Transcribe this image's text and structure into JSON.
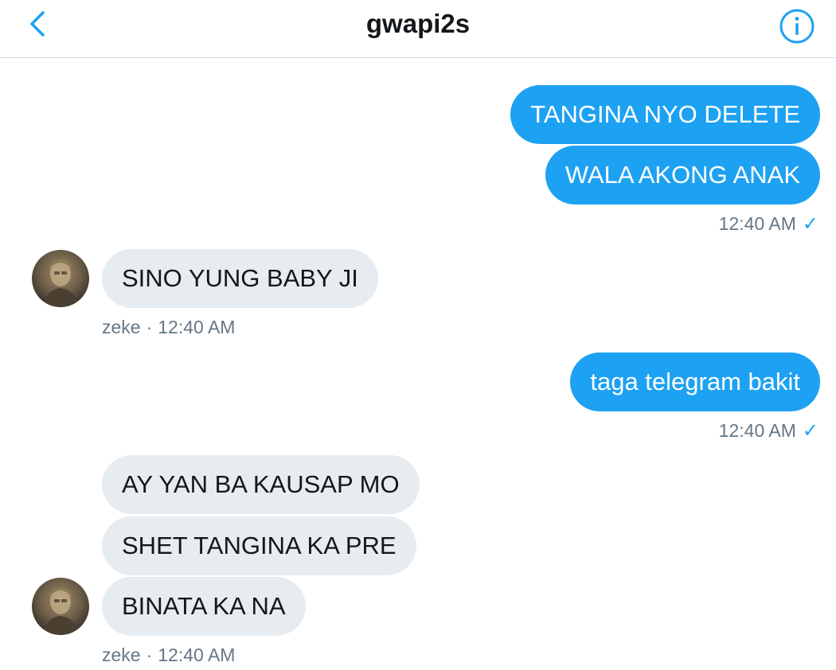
{
  "header": {
    "title": "gwapi2s",
    "back_icon": "chevron-left-icon",
    "info_icon": "info-circle-icon",
    "accent_color": "#1da1f2"
  },
  "messages": [
    {
      "direction": "sent",
      "text": "TANGINA NYO DELETE"
    },
    {
      "direction": "sent",
      "text": "WALA AKONG ANAK"
    },
    {
      "direction": "sent_meta",
      "time": "12:40 AM",
      "status_icon": "check-icon"
    },
    {
      "direction": "received",
      "text": "SINO YUNG BABY JI"
    },
    {
      "direction": "received_meta",
      "sender": "zeke",
      "separator": "·",
      "time": "12:40 AM"
    },
    {
      "direction": "sent",
      "text": "taga telegram bakit"
    },
    {
      "direction": "sent_meta",
      "time": "12:40 AM",
      "status_icon": "check-icon"
    },
    {
      "direction": "received",
      "text": "AY YAN BA KAUSAP MO"
    },
    {
      "direction": "received",
      "text": "SHET TANGINA KA PRE"
    },
    {
      "direction": "received",
      "text": "BINATA KA NA"
    },
    {
      "direction": "received_meta",
      "sender": "zeke",
      "separator": "·",
      "time": "12:40 AM"
    }
  ],
  "colors": {
    "sent_bubble": "#1da1f2",
    "received_bubble": "#e6ecf0",
    "meta_text": "#657786"
  }
}
